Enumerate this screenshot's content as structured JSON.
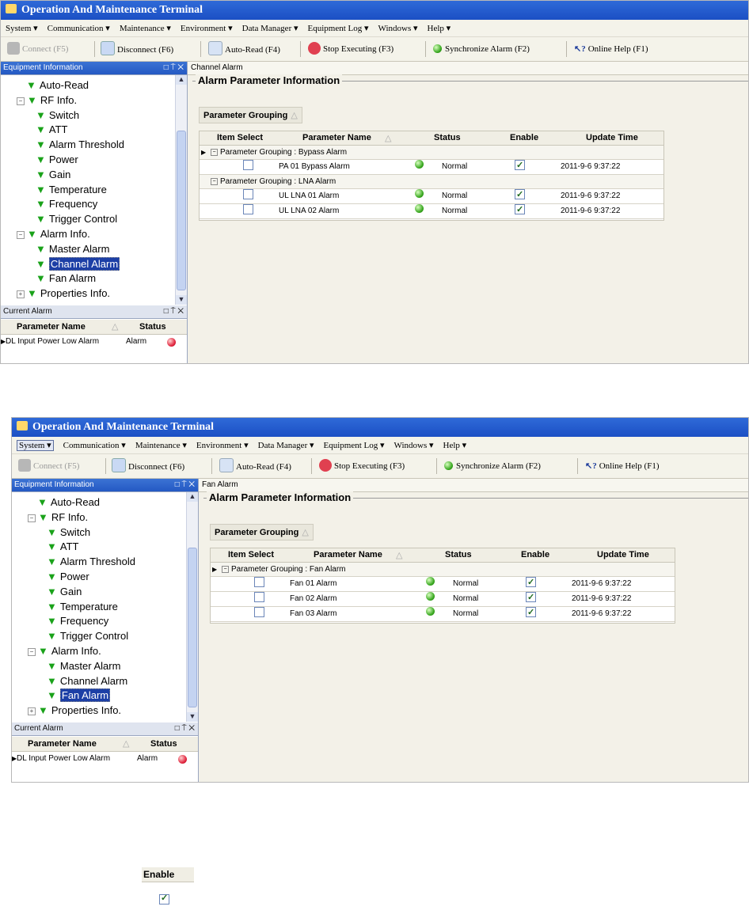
{
  "screens": [
    {
      "title": "Operation And Maintenance Terminal",
      "menu": [
        "System ▾",
        "Communication ▾",
        "Maintenance ▾",
        "Environment ▾",
        "Data Manager ▾",
        "Equipment Log ▾",
        "Windows ▾",
        "Help ▾"
      ],
      "toolbar": {
        "connect": "Connect (F5)",
        "disconnect": "Disconnect (F6)",
        "auto_read": "Auto-Read (F4)",
        "stop": "Stop Executing (F3)",
        "sync": "Synchronize Alarm (F2)",
        "help": "Online Help (F1)"
      },
      "equipment_pane_title": "Equipment Information",
      "tree": {
        "auto_read": "Auto-Read",
        "rf_info": "RF Info.",
        "switch": "Switch",
        "att": "ATT",
        "alarm_threshold": "Alarm Threshold",
        "power": "Power",
        "gain": "Gain",
        "temperature": "Temperature",
        "frequency": "Frequency",
        "trigger_control": "Trigger Control",
        "alarm_info": "Alarm Info.",
        "master_alarm": "Master Alarm",
        "channel_alarm": "Channel Alarm",
        "fan_alarm": "Fan Alarm",
        "properties_info": "Properties Info."
      },
      "selected_node": "channel_alarm",
      "current_alarm": {
        "title": "Current Alarm",
        "col_name": "Parameter Name",
        "col_status": "Status",
        "row_name": "DL Input Power Low Alarm",
        "row_status": "Alarm"
      },
      "tab_title": "Channel Alarm",
      "section_title": "Alarm Parameter Information",
      "group_button": "Parameter Grouping",
      "columns": {
        "item_select": "Item Select",
        "param_name": "Parameter Name",
        "status": "Status",
        "enable": "Enable",
        "update_time": "Update Time"
      },
      "groups": [
        {
          "label": "Parameter Grouping : Bypass Alarm",
          "rows": [
            {
              "name": "PA 01 Bypass Alarm",
              "status": "Normal",
              "time": "2011-9-6 9:37:22"
            }
          ]
        },
        {
          "label": "Parameter Grouping : LNA Alarm",
          "rows": [
            {
              "name": "UL LNA 01 Alarm",
              "status": "Normal",
              "time": "2011-9-6 9:37:22"
            },
            {
              "name": "UL LNA 02 Alarm",
              "status": "Normal",
              "time": "2011-9-6 9:37:22"
            }
          ]
        }
      ]
    },
    {
      "title": "Operation And Maintenance Terminal",
      "menu": [
        "System ▾",
        "Communication ▾",
        "Maintenance ▾",
        "Environment ▾",
        "Data Manager ▾",
        "Equipment Log ▾",
        "Windows ▾",
        "Help ▾"
      ],
      "toolbar": {
        "connect": "Connect (F5)",
        "disconnect": "Disconnect (F6)",
        "auto_read": "Auto-Read (F4)",
        "stop": "Stop Executing (F3)",
        "sync": "Synchronize Alarm (F2)",
        "help": "Online Help (F1)"
      },
      "equipment_pane_title": "Equipment Information",
      "tree": {
        "auto_read": "Auto-Read",
        "rf_info": "RF Info.",
        "switch": "Switch",
        "att": "ATT",
        "alarm_threshold": "Alarm Threshold",
        "power": "Power",
        "gain": "Gain",
        "temperature": "Temperature",
        "frequency": "Frequency",
        "trigger_control": "Trigger Control",
        "alarm_info": "Alarm Info.",
        "master_alarm": "Master Alarm",
        "channel_alarm": "Channel Alarm",
        "fan_alarm": "Fan Alarm",
        "properties_info": "Properties Info."
      },
      "selected_node": "fan_alarm",
      "current_alarm": {
        "title": "Current Alarm",
        "col_name": "Parameter Name",
        "col_status": "Status",
        "row_name": "DL Input Power Low Alarm",
        "row_status": "Alarm"
      },
      "tab_title": "Fan Alarm",
      "section_title": "Alarm Parameter Information",
      "group_button": "Parameter Grouping",
      "columns": {
        "item_select": "Item Select",
        "param_name": "Parameter Name",
        "status": "Status",
        "enable": "Enable",
        "update_time": "Update Time"
      },
      "groups": [
        {
          "label": "Parameter Grouping : Fan Alarm",
          "rows": [
            {
              "name": "Fan 01 Alarm",
              "status": "Normal",
              "time": "2011-9-6 9:37:22"
            },
            {
              "name": "Fan 02 Alarm",
              "status": "Normal",
              "time": "2011-9-6 9:37:22"
            },
            {
              "name": "Fan 03 Alarm",
              "status": "Normal",
              "time": "2011-9-6 9:37:22"
            }
          ]
        }
      ]
    }
  ],
  "enable_crop": {
    "label": "Enable",
    "checked": true
  }
}
